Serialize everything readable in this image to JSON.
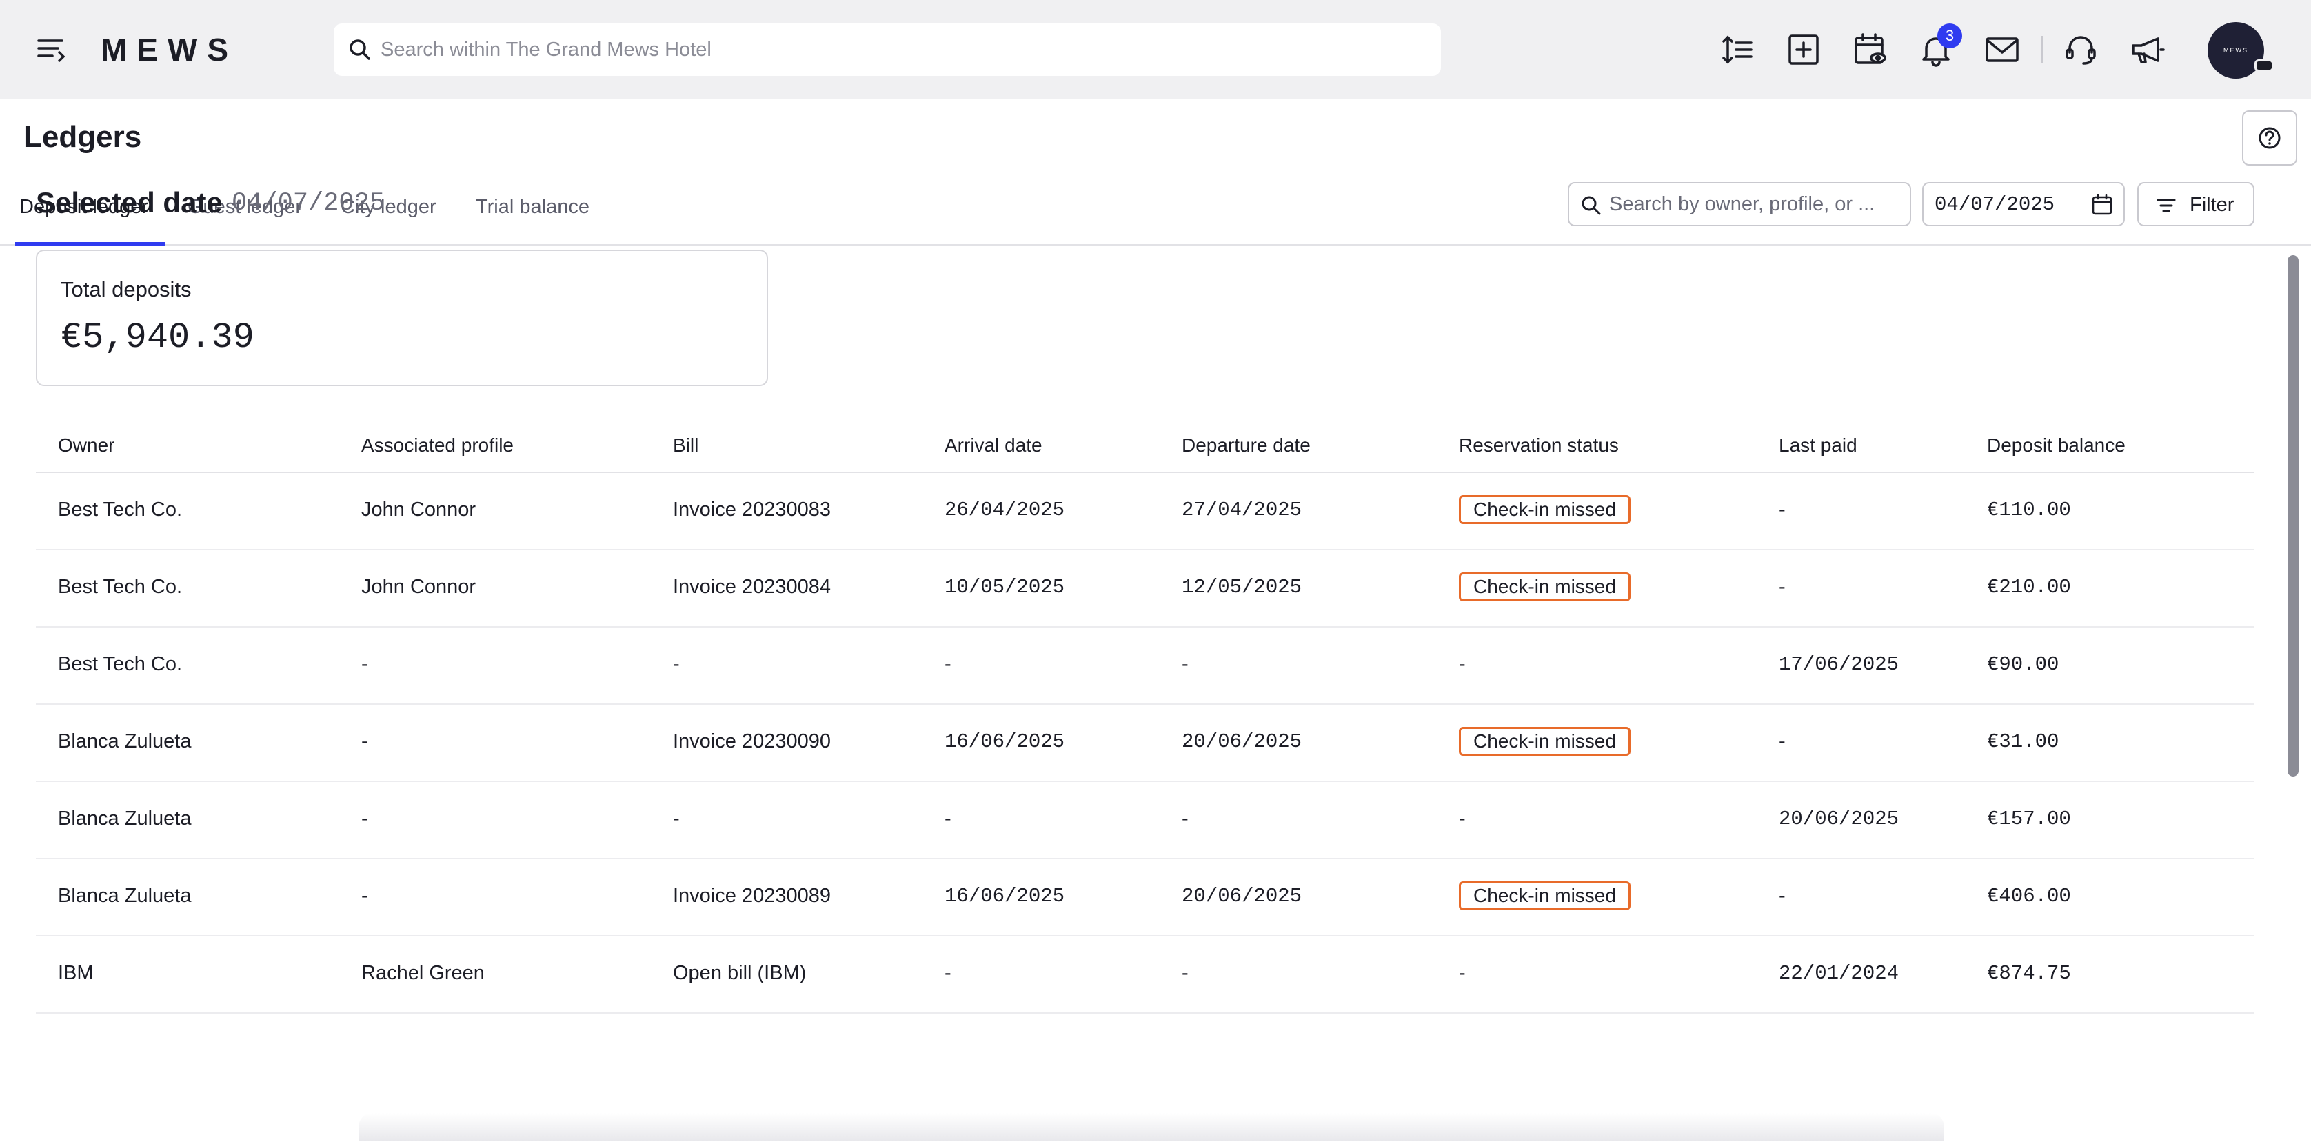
{
  "app": {
    "logo_text": "MEWS",
    "search_placeholder": "Search within The Grand Mews Hotel",
    "notification_count": "3",
    "avatar_text": "MEWS"
  },
  "page": {
    "title": "Ledgers",
    "tabs": [
      {
        "label": "Deposit ledger",
        "active": true
      },
      {
        "label": "Guest ledger",
        "active": false
      },
      {
        "label": "City ledger",
        "active": false
      },
      {
        "label": "Trial balance",
        "active": false
      }
    ]
  },
  "toolbar": {
    "selected_date_label": "Selected date",
    "selected_date_value": "04/07/2025",
    "search_placeholder": "Search by owner, profile, or ...",
    "date_value": "04/07/2025",
    "filter_label": "Filter"
  },
  "summary": {
    "label": "Total deposits",
    "value": "€5,940.39"
  },
  "table": {
    "columns": [
      "Owner",
      "Associated profile",
      "Bill",
      "Arrival date",
      "Departure date",
      "Reservation status",
      "Last paid",
      "Deposit balance"
    ],
    "rows": [
      {
        "owner": "Best Tech Co.",
        "profile": "John Connor",
        "bill": "Invoice 20230083",
        "arrival": "26/04/2025",
        "departure": "27/04/2025",
        "status": "Check-in missed",
        "last_paid": "-",
        "balance": "€110.00"
      },
      {
        "owner": "Best Tech Co.",
        "profile": "John Connor",
        "bill": "Invoice 20230084",
        "arrival": "10/05/2025",
        "departure": "12/05/2025",
        "status": "Check-in missed",
        "last_paid": "-",
        "balance": "€210.00"
      },
      {
        "owner": "Best Tech Co.",
        "profile": "-",
        "bill": "-",
        "arrival": "-",
        "departure": "-",
        "status": "-",
        "last_paid": "17/06/2025",
        "balance": "€90.00"
      },
      {
        "owner": "Blanca Zulueta",
        "profile": "-",
        "bill": "Invoice 20230090",
        "arrival": "16/06/2025",
        "departure": "20/06/2025",
        "status": "Check-in missed",
        "last_paid": "-",
        "balance": "€31.00"
      },
      {
        "owner": "Blanca Zulueta",
        "profile": "-",
        "bill": "-",
        "arrival": "-",
        "departure": "-",
        "status": "-",
        "last_paid": "20/06/2025",
        "balance": "€157.00"
      },
      {
        "owner": "Blanca Zulueta",
        "profile": "-",
        "bill": "Invoice 20230089",
        "arrival": "16/06/2025",
        "departure": "20/06/2025",
        "status": "Check-in missed",
        "last_paid": "-",
        "balance": "€406.00"
      },
      {
        "owner": "IBM",
        "profile": "Rachel Green",
        "bill": "Open bill (IBM)",
        "arrival": "-",
        "departure": "-",
        "status": "-",
        "last_paid": "22/01/2024",
        "balance": "€874.75"
      }
    ]
  },
  "colors": {
    "accent": "#2f3bf0",
    "status_warning": "#e86b2a",
    "topbar_bg": "#f0f0f2"
  },
  "icons": [
    "menu-icon",
    "search-icon",
    "row-height-icon",
    "add-icon",
    "calendar-view-icon",
    "bell-icon",
    "mail-icon",
    "headset-icon",
    "megaphone-icon",
    "help-icon",
    "calendar-icon",
    "filter-icon"
  ]
}
